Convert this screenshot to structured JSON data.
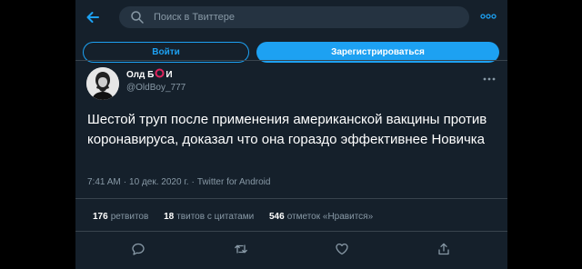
{
  "search": {
    "placeholder": "Поиск в Твиттере",
    "icon": "search-icon"
  },
  "auth": {
    "login_label": "Войти",
    "signup_label": "Зарегистрироваться"
  },
  "tweet": {
    "author_name_prefix": "Олд Б",
    "author_name_suffix": "И",
    "author_handle": "@OldBoy_777",
    "text": "Шестой труп после применения американской вакцины против коронавируса, доказал что она гораздо эффективнее Новичка",
    "time": "7:41 AM",
    "date": "10 дек. 2020 г.",
    "separator": "·",
    "source": "Twitter for Android",
    "stats": {
      "retweets_count": "176",
      "retweets_label": "ретвитов",
      "quotes_count": "18",
      "quotes_label": "твитов с цитатами",
      "likes_count": "546",
      "likes_label": "отметок «Нравится»"
    },
    "actions": [
      "reply-icon",
      "retweet-icon",
      "like-icon",
      "share-icon"
    ]
  },
  "colors": {
    "accent": "#1da1f2",
    "background": "#15202b",
    "muted_text": "#8899a6",
    "logo_red": "#e0245e"
  }
}
